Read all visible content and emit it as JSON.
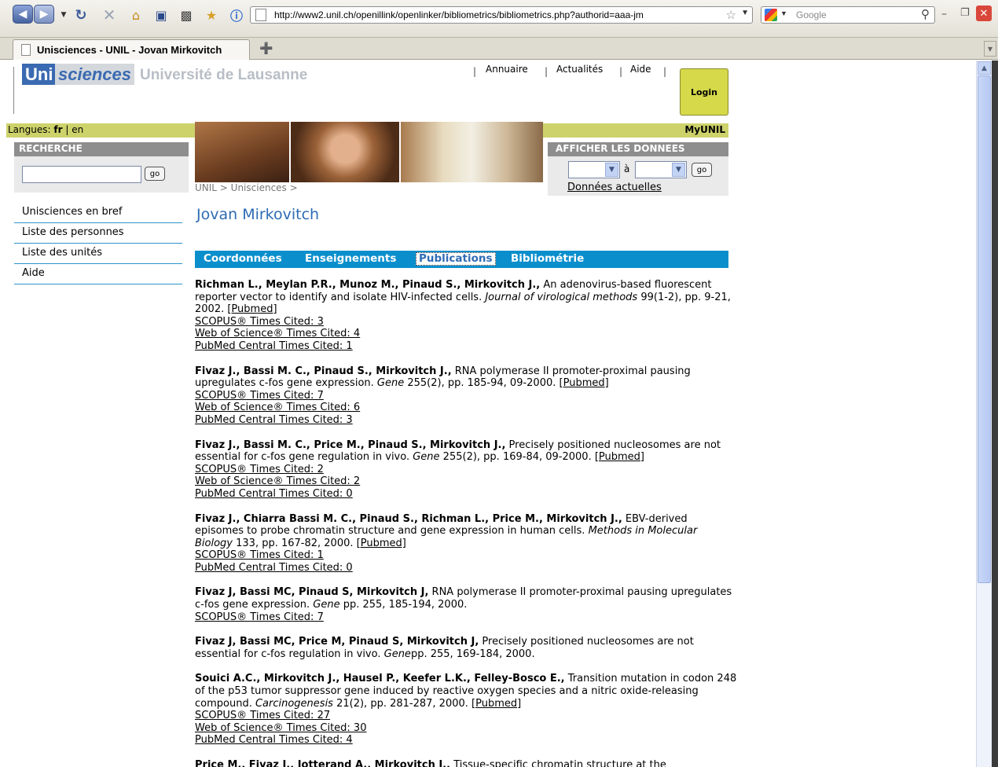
{
  "browser": {
    "url": "http://www2.unil.ch/openillink/openlinker/bibliometrics/bibliometrics.php?authorid=aaa-jm",
    "search_placeholder": "Google",
    "tab_title": "Unisciences - UNIL - Jovan Mirkovitch"
  },
  "header": {
    "logo_uni": "Uni",
    "logo_sciences": "sciences",
    "university": "Université de Lausanne",
    "links": [
      "Annuaire",
      "Actualités",
      "Aide"
    ],
    "login": "Login"
  },
  "lang": {
    "label": "Langues:",
    "fr": "fr",
    "sep": "|",
    "en": "en"
  },
  "myunil": "MyUNIL",
  "search": {
    "heading": "RECHERCHE",
    "go": "go"
  },
  "data_panel": {
    "heading": "AFFICHER LES DONNEES",
    "to": "à",
    "go": "go",
    "current": "Données actuelles"
  },
  "breadcrumb": "UNIL > Unisciences >",
  "sidebar": [
    "Unisciences en bref",
    "Liste des personnes",
    "Liste des unités",
    "Aide"
  ],
  "person": {
    "name": "Jovan Mirkovitch"
  },
  "tabs": [
    "Coordonnées",
    "Enseignements",
    "Publications",
    "Bibliométrie"
  ],
  "publications": [
    {
      "authors": "Richman L., Meylan P.R., Munoz M., Pinaud S., Mirkovitch J.,",
      "title": " An adenovirus-based fluorescent reporter vector to identify and isolate HIV-infected cells. ",
      "journal": "Journal of virological methods",
      "details": " 99(1-2), pp. 9-21, 2002. ",
      "pubmed": "[Pubmed]",
      "citations": [
        "SCOPUS® Times Cited: 3",
        "Web of Science® Times Cited: 4",
        "PubMed Central Times Cited: 1"
      ]
    },
    {
      "authors": "Fivaz J., Bassi M. C., Pinaud S., Mirkovitch J.,",
      "title": " RNA polymerase II promoter-proximal pausing upregulates c-fos gene expression. ",
      "journal": "Gene",
      "details": " 255(2), pp. 185-94, 09-2000. ",
      "pubmed": "[Pubmed]",
      "citations": [
        "SCOPUS® Times Cited: 7",
        "Web of Science® Times Cited: 6",
        "PubMed Central Times Cited: 3"
      ]
    },
    {
      "authors": "Fivaz J., Bassi M. C., Price M., Pinaud S., Mirkovitch J.,",
      "title": " Precisely positioned nucleosomes are not essential for c-fos gene regulation in vivo. ",
      "journal": "Gene",
      "details": " 255(2), pp. 169-84, 09-2000. ",
      "pubmed": "[Pubmed]",
      "citations": [
        "SCOPUS® Times Cited: 2",
        "Web of Science® Times Cited: 2",
        "PubMed Central Times Cited: 0"
      ]
    },
    {
      "authors": "Fivaz J., Chiarra Bassi M. C., Pinaud S., Richman L., Price M., Mirkovitch J.,",
      "title": " EBV-derived episomes to probe chromatin structure and gene expression in human cells. ",
      "journal": "Methods in Molecular Biology",
      "details": " 133, pp. 167-82, 2000. ",
      "pubmed": "[Pubmed]",
      "citations": [
        "SCOPUS® Times Cited: 1",
        "PubMed Central Times Cited: 0"
      ]
    },
    {
      "authors": "Fivaz J, Bassi MC, Pinaud S, Mirkovitch J,",
      "title": " RNA polymerase II promoter-proximal pausing upregulates c-fos gene expression. ",
      "journal": "Gene",
      "details": " pp. 255, 185-194, 2000.",
      "pubmed": "",
      "citations": [
        "SCOPUS® Times Cited: 7"
      ]
    },
    {
      "authors": "Fivaz J, Bassi MC, Price M, Pinaud S, Mirkovitch J,",
      "title": " Precisely positioned nucleosomes are not essential for c-fos regulation in vivo. ",
      "journal": "Gene",
      "details": "pp. 255, 169-184, 2000.",
      "pubmed": "",
      "citations": []
    },
    {
      "authors": "Souici A.C., Mirkovitch J., Hausel P., Keefer L.K., Felley-Bosco E.,",
      "title": " Transition mutation in codon 248 of the p53 tumor suppressor gene induced by reactive oxygen species and a nitric oxide-releasing compound. ",
      "journal": "Carcinogenesis",
      "details": " 21(2), pp. 281-287, 2000. ",
      "pubmed": "[Pubmed]",
      "citations": [
        "SCOPUS® Times Cited: 27",
        "Web of Science® Times Cited: 30",
        "PubMed Central Times Cited: 4"
      ]
    },
    {
      "authors": "Price M., Fivaz J., Jotterand A., Mirkovitch J.,",
      "title": " Tissue-specific chromatin structure at the",
      "journal": "",
      "details": "",
      "pubmed": "",
      "citations": []
    }
  ],
  "colors": {
    "accent_blue": "#0b8fcc",
    "title_blue": "#2e6bb4",
    "lime_bar": "#cdd26a",
    "panel_grey": "#8e8e8e"
  },
  "icons": [
    "back-icon",
    "forward-icon",
    "reload-icon",
    "stop-icon",
    "home-icon",
    "save-icon",
    "print-icon",
    "bookmark-icon",
    "info-icon",
    "star-icon",
    "search-icon",
    "close-icon"
  ]
}
